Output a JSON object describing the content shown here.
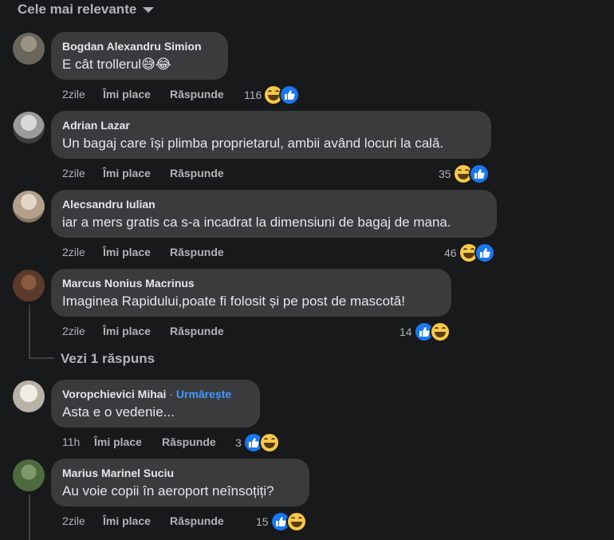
{
  "sort": {
    "label": "Cele mai relevante"
  },
  "actions": {
    "like": "Îmi place",
    "reply": "Răspunde"
  },
  "comments": [
    {
      "author": "Bogdan Alexandru Simion",
      "text": "E cât trollerul😅😂",
      "time": "2zile",
      "count": "116",
      "reactions": [
        "haha",
        "like"
      ],
      "avatar_color": "#7b7466"
    },
    {
      "author": "Adrian Lazar",
      "text": "Un bagaj care își plimba proprietarul, ambii având locuri la cală.",
      "time": "2zile",
      "count": "35",
      "reactions": [
        "haha",
        "like"
      ],
      "avatar_color": "#a8a9ab"
    },
    {
      "author": "Alecsandru Iulian",
      "text": "iar a mers gratis ca s-a incadrat la dimensiuni de bagaj de mana.",
      "time": "2zile",
      "count": "46",
      "reactions": [
        "haha",
        "like"
      ],
      "avatar_color": "#c9b8a6"
    },
    {
      "author": "Marcus Nonius Macrinus",
      "text": "Imaginea Rapidului,poate fi folosit și pe post de mascotă!",
      "time": "2zile",
      "count": "14",
      "reactions": [
        "like",
        "haha"
      ],
      "avatar_color": "#6a4a3a"
    },
    {
      "author": "Voropchievici Mihai",
      "follow": "Urmărește",
      "text": "Asta e o vedenie...",
      "time": "11h",
      "count": "3",
      "reactions": [
        "like",
        "haha"
      ],
      "avatar_color": "#d8d4cc"
    },
    {
      "author": "Marius Marinel Suciu",
      "text": "Au voie copii în aeroport neînsoțiți?",
      "time": "2zile",
      "count": "15",
      "reactions": [
        "like",
        "haha"
      ],
      "avatar_color": "#5d7d4c"
    }
  ],
  "replies_link": "Vezi 1 răspuns"
}
